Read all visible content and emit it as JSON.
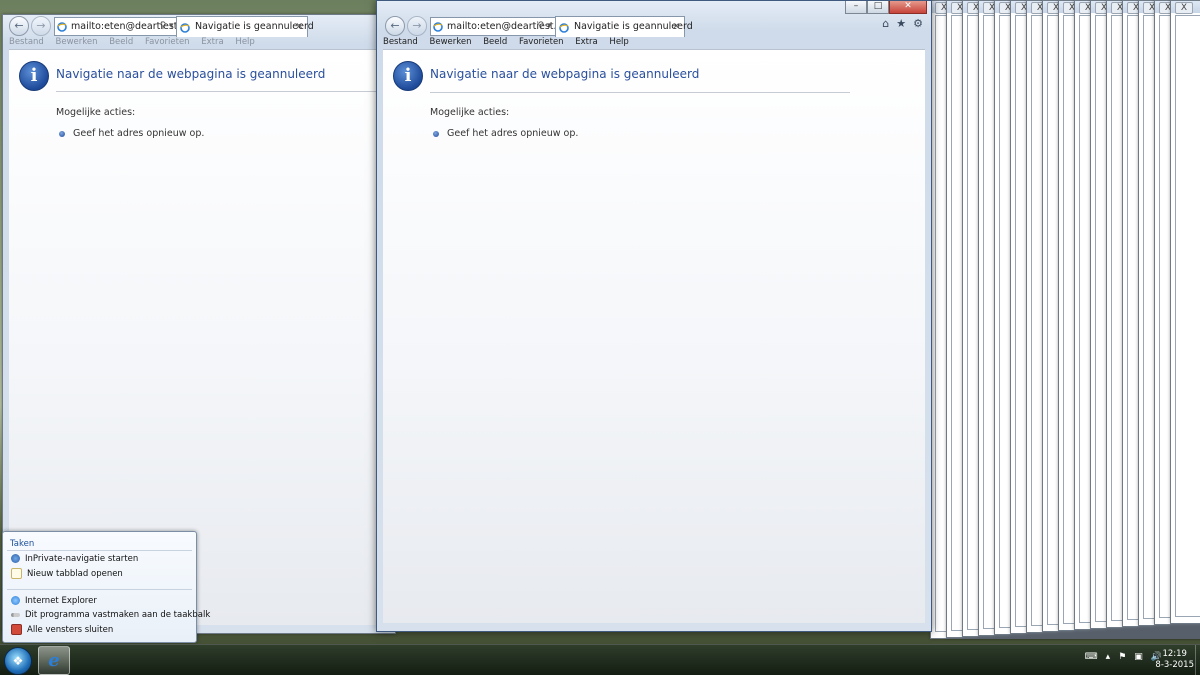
{
  "browser": {
    "address_value": "mailto:eten@deartiest.n",
    "tab_title": "Navigatie is geannuleerd",
    "menu": [
      "Bestand",
      "Bewerken",
      "Beeld",
      "Favorieten",
      "Extra",
      "Help"
    ]
  },
  "error_page": {
    "title": "Navigatie naar de webpagina is geannuleerd",
    "actions_label": "Mogelijke acties:",
    "action_item": "Geef het adres opnieuw op."
  },
  "stacked_window_close": "X",
  "jumplist": {
    "header": "Taken",
    "tasks": [
      {
        "label": "InPrivate-navigatie starten",
        "icon": "inprivate-icon"
      },
      {
        "label": "Nieuw tabblad openen",
        "icon": "new-tab-icon"
      }
    ],
    "program_items": [
      {
        "label": "Internet Explorer",
        "icon": "ie-icon"
      },
      {
        "label": "Dit programma vastmaken aan de taakbalk",
        "icon": "pin-icon"
      },
      {
        "label": "Alle vensters sluiten",
        "icon": "close-all-icon"
      }
    ]
  },
  "taskbar": {
    "time": "12:19",
    "date": "8-3-2015"
  },
  "colors": {
    "title_blue": "#2a4f9c",
    "close_red": "#c7433a"
  }
}
